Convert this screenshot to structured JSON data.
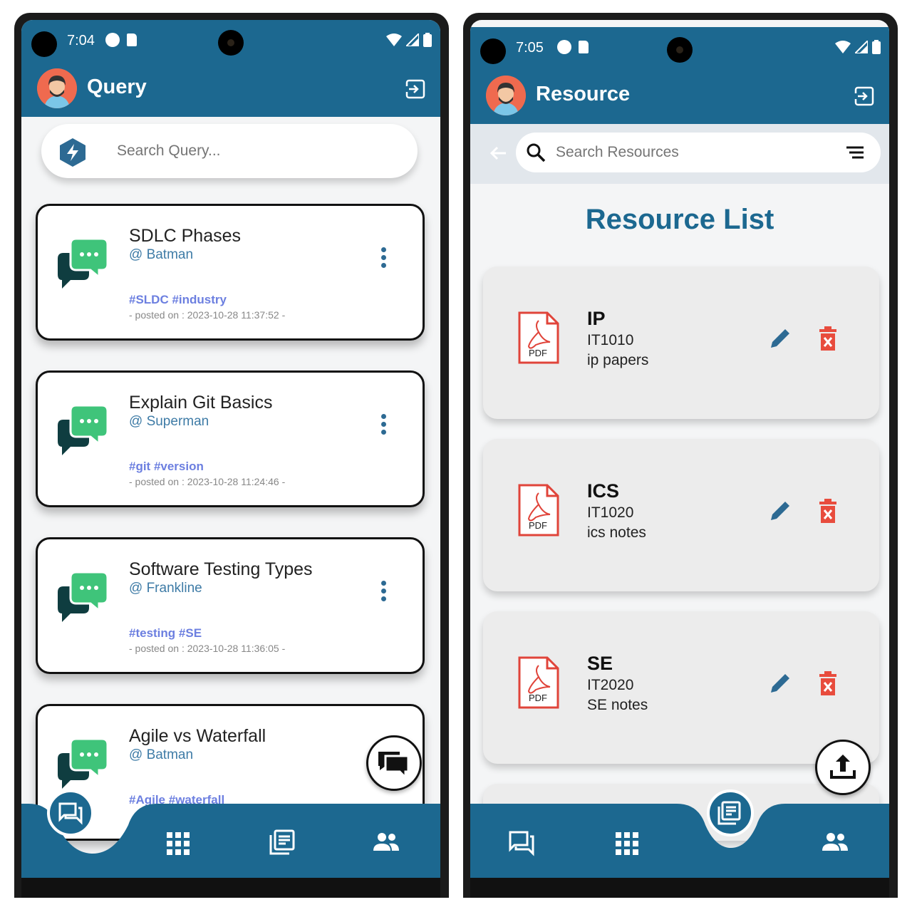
{
  "query_screen": {
    "status": {
      "time": "7:04"
    },
    "appbar": {
      "title": "Query"
    },
    "search": {
      "placeholder": "Search Query..."
    },
    "queries": [
      {
        "title": "SDLC Phases",
        "author": "@ Batman",
        "tags": "#SLDC #industry",
        "posted": "- posted on : 2023-10-28 11:37:52 -"
      },
      {
        "title": "Explain Git Basics",
        "author": "@ Superman",
        "tags": "#git #version",
        "posted": "- posted on : 2023-10-28 11:24:46 -"
      },
      {
        "title": "Software Testing Types",
        "author": "@ Frankline",
        "tags": "#testing #SE",
        "posted": "- posted on : 2023-10-28 11:36:05 -"
      },
      {
        "title": "Agile vs Waterfall",
        "author": "@ Batman",
        "tags": "#Agile #waterfall",
        "posted": ""
      }
    ],
    "nav": {
      "active": "queries"
    }
  },
  "resource_screen": {
    "status": {
      "time": "7:05"
    },
    "appbar": {
      "title": "Resource"
    },
    "search": {
      "placeholder": "Search Resources"
    },
    "list_title": "Resource List",
    "resources": [
      {
        "name": "IP",
        "code": "IT1010",
        "desc": "ip papers",
        "file_label": "PDF"
      },
      {
        "name": "ICS",
        "code": "IT1020",
        "desc": "ics notes",
        "file_label": "PDF"
      },
      {
        "name": "SE",
        "code": "IT2020",
        "desc": "SE notes",
        "file_label": "PDF"
      }
    ],
    "nav": {
      "active": "resources"
    }
  },
  "colors": {
    "primary": "#1c6890",
    "chat_green": "#3fc47a",
    "chat_dark": "#0f3d40",
    "delete_red": "#e84c3d",
    "pdf_red": "#e0443a",
    "tag_blue": "#6c7fe0"
  }
}
